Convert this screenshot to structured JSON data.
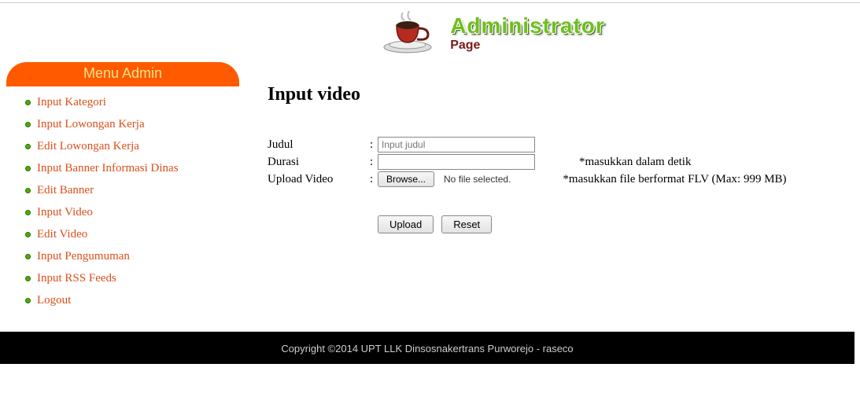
{
  "header": {
    "title": "Administrator",
    "subtitle": "Page"
  },
  "sidebar": {
    "heading": "Menu Admin",
    "items": [
      {
        "label": "Input Kategori"
      },
      {
        "label": "Input Lowongan Kerja"
      },
      {
        "label": "Edit Lowongan Kerja"
      },
      {
        "label": "Input Banner Informasi Dinas"
      },
      {
        "label": "Edit Banner"
      },
      {
        "label": "Input Video"
      },
      {
        "label": "Edit Video"
      },
      {
        "label": "Input Pengumuman"
      },
      {
        "label": "Input RSS Feeds"
      },
      {
        "label": "Logout"
      }
    ]
  },
  "main": {
    "title": "Input video",
    "fields": {
      "judul_label": "Judul",
      "judul_placeholder": "Input judul",
      "durasi_label": "Durasi",
      "durasi_hint": "*masukkan dalam detik",
      "upload_label": "Upload Video",
      "browse_label": "Browse...",
      "nofile_text": "No file selected.",
      "upload_hint": "*masukkan file berformat FLV (Max: 999 MB)"
    },
    "buttons": {
      "upload": "Upload",
      "reset": "Reset"
    }
  },
  "footer": {
    "text": "Copyright ©2014 UPT LLK Dinsosnakertrans Purworejo - raseco"
  }
}
